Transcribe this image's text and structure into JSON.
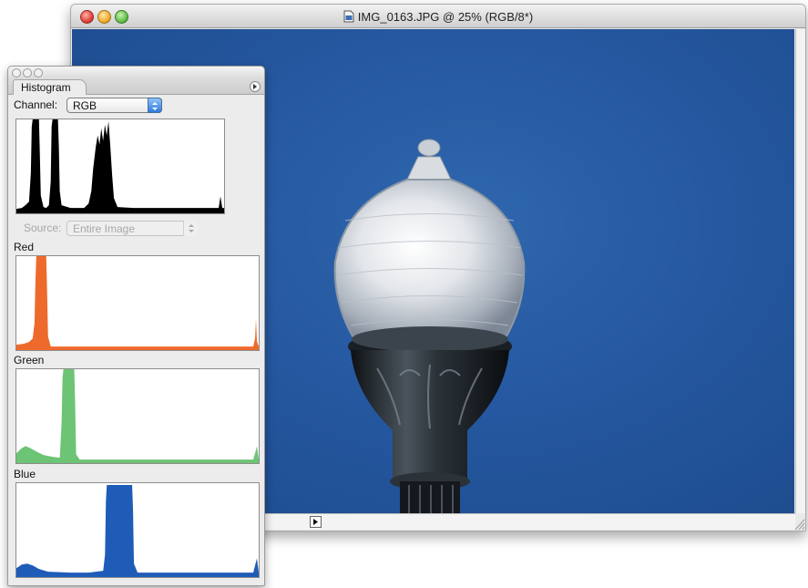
{
  "document_window": {
    "title": "IMG_0163.JPG @ 25% (RGB/8*)"
  },
  "histogram_panel": {
    "tab_label": "Histogram",
    "channel_label": "Channel:",
    "channel_value": "RGB",
    "source_label": "Source:",
    "source_value": "Entire Image",
    "red_label": "Red",
    "green_label": "Green",
    "blue_label": "Blue"
  },
  "colors": {
    "composite": "#000000",
    "red": "#ee6a2c",
    "green": "#6cc474",
    "blue": "#1e5cb8",
    "sky": "#2558a0"
  },
  "icons": [
    "close-icon",
    "minimize-icon",
    "zoom-icon",
    "file-icon",
    "panel-menu-icon",
    "chevron-up-down-icon",
    "play-arrow-icon",
    "resize-grip-icon"
  ]
}
